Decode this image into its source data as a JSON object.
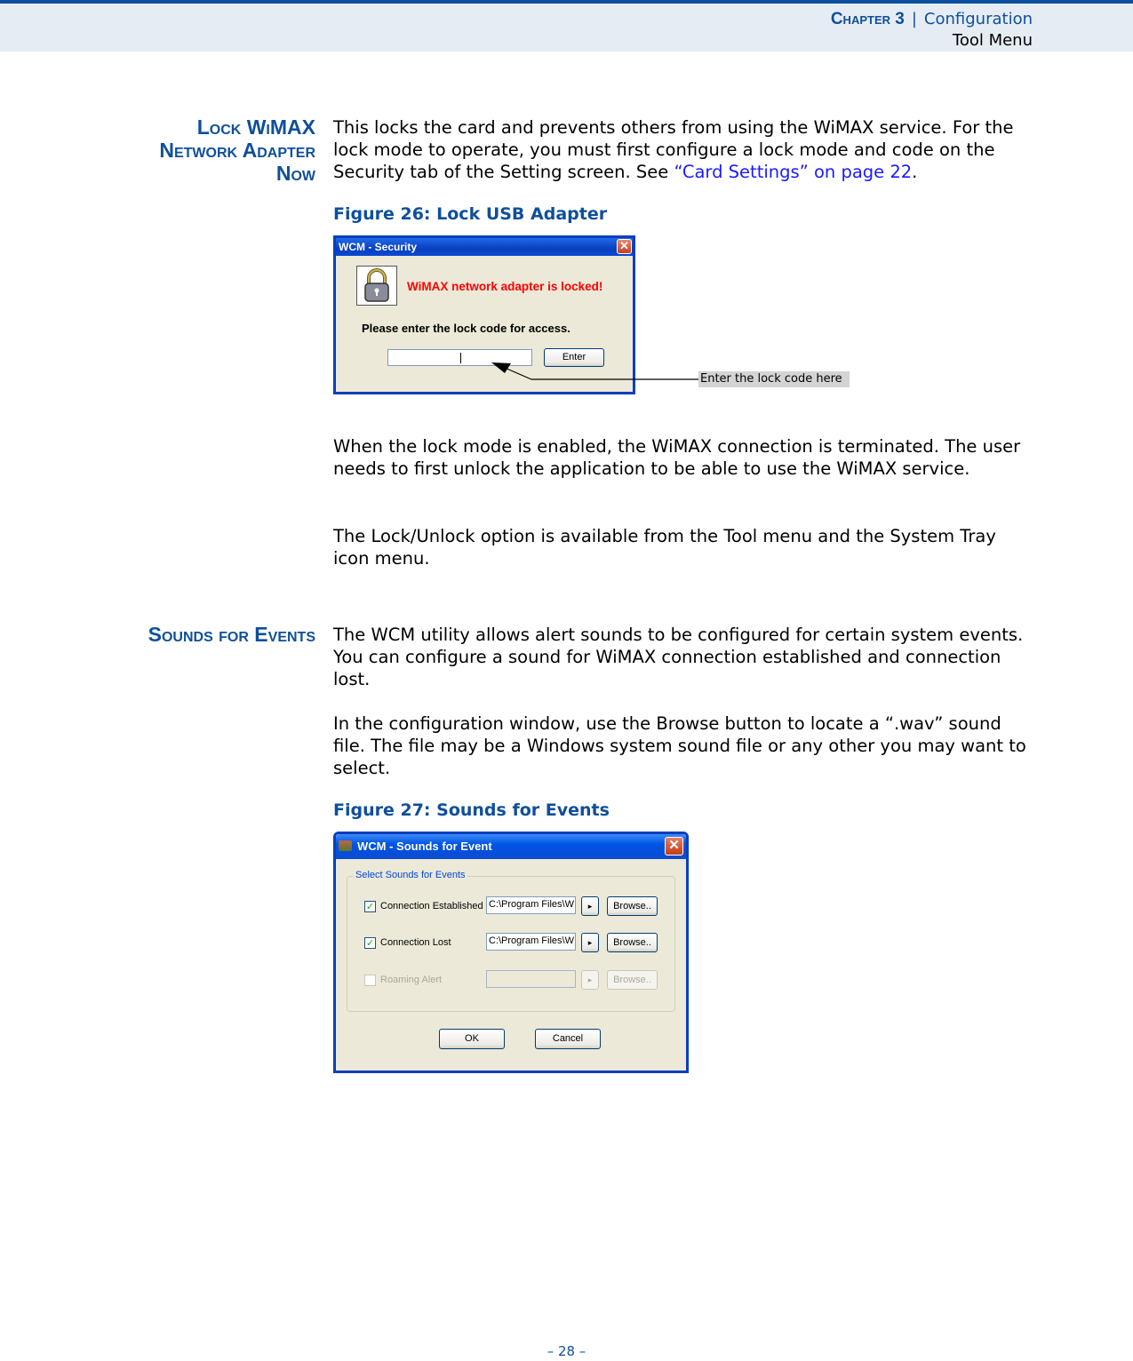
{
  "header": {
    "chapter": "Chapter 3",
    "separator": "|",
    "chapter_title": "Configuration",
    "section": "Tool Menu"
  },
  "lock_section": {
    "heading_lines": [
      "Lock WiMAX",
      "Network Adapter",
      "Now"
    ],
    "intro_before_link": "This locks the card and prevents others from using the WiMAX service. For the lock mode to operate, you must first configure a lock mode and code on the Security tab of the Setting screen. See ",
    "intro_link": "“Card Settings” on page 22",
    "intro_after_link": ".",
    "figure_caption": "Figure 26:  Lock USB Adapter",
    "dialog": {
      "title": "WCM - Security",
      "close_glyph": "✕",
      "icon": "padlock-icon",
      "alert_text": "WiMAX network adapter is locked!",
      "prompt": "Please enter the lock code for access.",
      "lock_code_value": "",
      "enter_button": "Enter"
    },
    "callout": "Enter the lock code here",
    "para2": "When the lock mode is enabled, the WiMAX connection is terminated. The user needs to first unlock the application to be able to use the WiMAX service.",
    "para3": "The Lock/Unlock option is available from the Tool menu and the System Tray icon menu."
  },
  "sounds_section": {
    "heading": "Sounds for Events",
    "para1": "The WCM utility allows alert sounds to be configured for certain system events. You can configure a sound for WiMAX connection established and connection lost.",
    "para2": "In the configuration window, use the Browse button to locate a “.wav” sound file. The file may be a Windows system sound file or any other you may want to select.",
    "figure_caption": "Figure 27:  Sounds for Events",
    "dialog": {
      "title": "WCM - Sounds for Event",
      "close_glyph": "✕",
      "group_label": "Select Sounds for Events",
      "rows": [
        {
          "label": "Connection Established",
          "checked": true,
          "enabled": true,
          "path": "C:\\Program Files\\W",
          "play": "▸",
          "browse": "Browse.."
        },
        {
          "label": "Connection Lost",
          "checked": true,
          "enabled": true,
          "path": "C:\\Program Files\\W",
          "play": "▸",
          "browse": "Browse.."
        },
        {
          "label": "Roaming Alert",
          "checked": false,
          "enabled": false,
          "path": "",
          "play": "▸",
          "browse": "Browse.."
        }
      ],
      "ok_button": "OK",
      "cancel_button": "Cancel"
    }
  },
  "footer": {
    "page_number": "–  28  –"
  }
}
